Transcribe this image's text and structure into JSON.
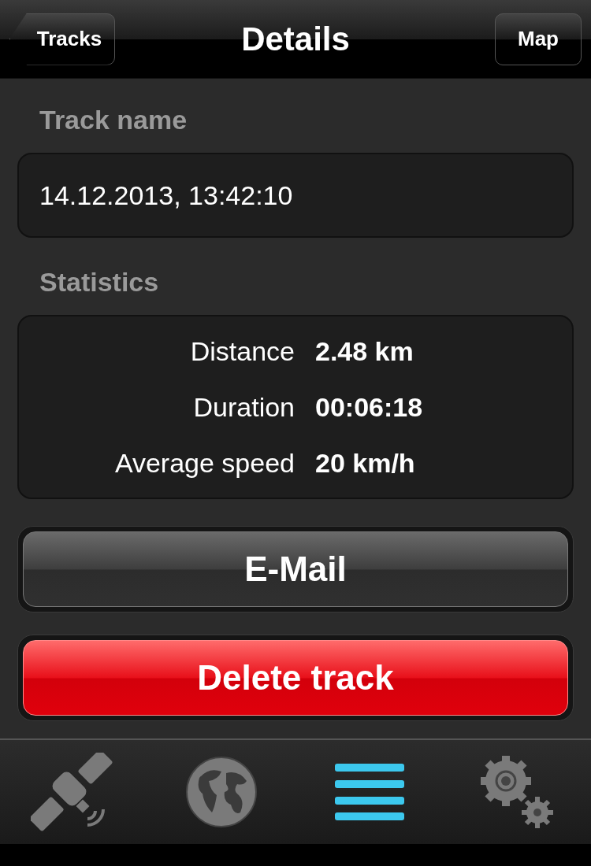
{
  "nav_bar": {
    "back_button": "Tracks",
    "title": "Details",
    "right_button": "Map"
  },
  "track_name": {
    "label": "Track name",
    "value": "14.12.2013, 13:42:10"
  },
  "statistics": {
    "label": "Statistics",
    "rows": [
      {
        "label": "Distance",
        "value": "2.48 km"
      },
      {
        "label": "Duration",
        "value": "00:06:18"
      },
      {
        "label": "Average speed",
        "value": "20 km/h"
      }
    ]
  },
  "buttons": [
    {
      "label": "E-Mail",
      "kind": "normal"
    },
    {
      "label": "Delete track",
      "kind": "destructive"
    }
  ],
  "tab_bar": [
    {
      "kind": "satellite",
      "selected": false
    },
    {
      "kind": "globe",
      "selected": false
    },
    {
      "kind": "list",
      "selected": true
    },
    {
      "kind": "settings",
      "selected": false
    }
  ]
}
